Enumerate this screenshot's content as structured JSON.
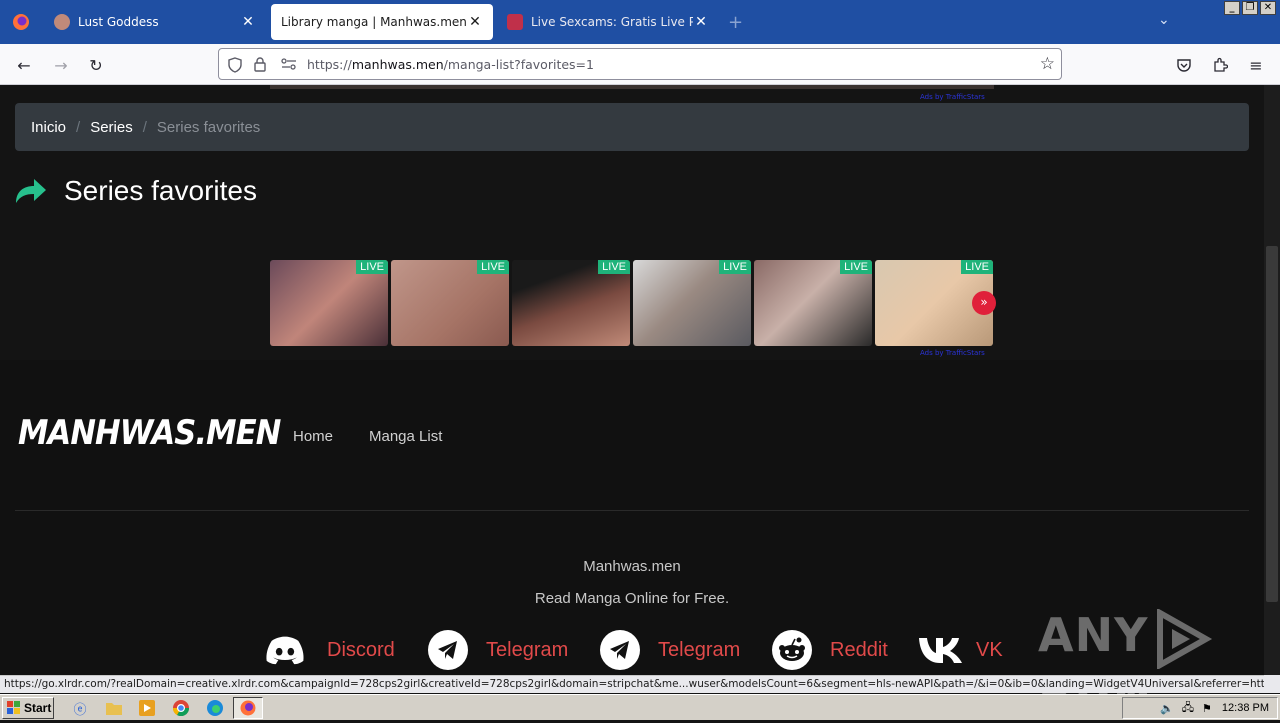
{
  "browser": {
    "tabs": [
      {
        "title": "Lust Goddess",
        "active": false
      },
      {
        "title": "Library manga | Manhwas.men",
        "active": true
      },
      {
        "title": "Live Sexcams: Gratis Live Porn Cha",
        "active": false
      }
    ],
    "new_tab": "+",
    "url_scheme": "https://",
    "url_domain": "manhwas.men",
    "url_path": "/manga-list?favorites=1"
  },
  "page": {
    "breadcrumb": [
      "Inicio",
      "Series",
      "Series favorites"
    ],
    "breadcrumb_sep": "/",
    "heading": "Series favorites",
    "live_badge": "LIVE",
    "ads_by": "Ads by TrafficStars",
    "cam_count": 6,
    "footer": {
      "logo": "MANHWAS.MEN",
      "nav": [
        "Home",
        "Manga List"
      ],
      "brand": "Manhwas.men",
      "tagline": "Read Manga Online for Free.",
      "social": [
        "Discord",
        "Telegram",
        "Telegram",
        "Reddit",
        "VK"
      ]
    }
  },
  "watermark": "ANY RUN",
  "status_url": "https://go.xlrdr.com/?realDomain=creative.xlrdr.com&campaignId=728cps2girl&creativeId=728cps2girl&domain=stripchat&me...wuser&modelsCount=6&segment=hls-newAPI&path=/&i=0&ib=0&landing=WidgetV4Universal&referrer=https://r.trackwilltrk.com/",
  "taskbar": {
    "start": "Start",
    "clock": "12:38 PM"
  },
  "colors": {
    "tab_strip": "#1f4fa3",
    "accent_green": "#1fb37a",
    "social_red": "#e14a4a"
  }
}
